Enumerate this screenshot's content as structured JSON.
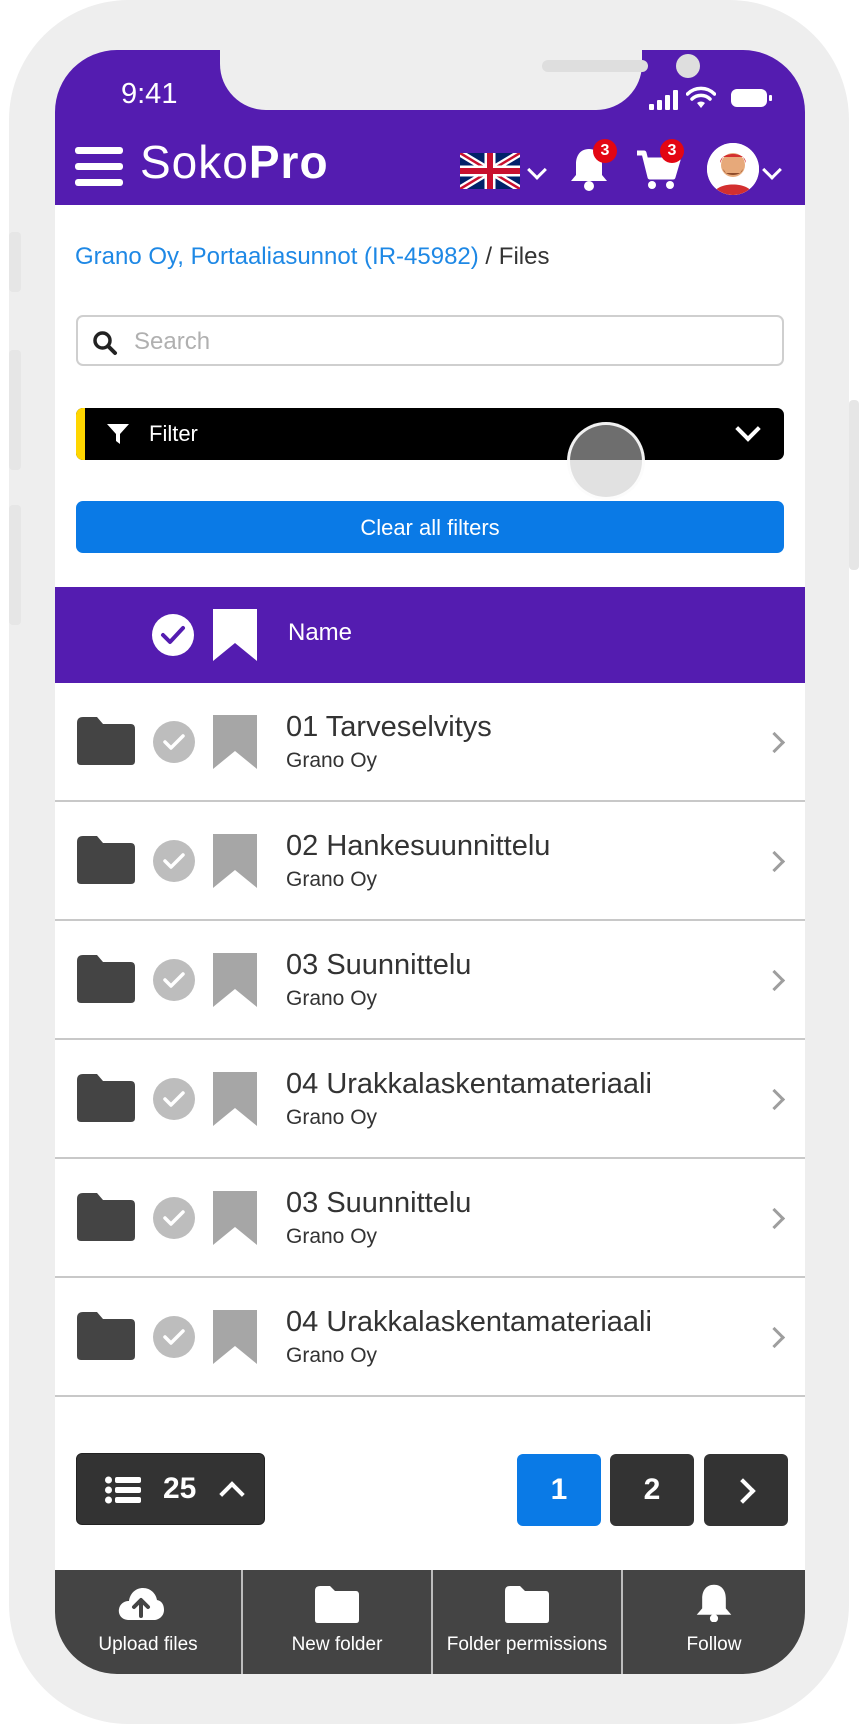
{
  "status_bar": {
    "time": "9:41"
  },
  "header": {
    "logo_light": "Soko",
    "logo_bold": "Pro",
    "notifications_count": "3",
    "cart_count": "3",
    "colors": {
      "brand": "#541cb0",
      "badge": "#e30613"
    }
  },
  "breadcrumb": {
    "link": "Grano Oy, Portaaliasunnot (IR-45982)",
    "separator": " / ",
    "current": "Files"
  },
  "search": {
    "placeholder": "Search",
    "value": ""
  },
  "filter": {
    "label": "Filter",
    "accent_color": "#ffd600"
  },
  "clear_filters": {
    "label": "Clear all filters",
    "color": "#0a7ae6"
  },
  "table": {
    "header": {
      "name": "Name"
    },
    "rows": [
      {
        "title": "01 Tarveselvitys",
        "owner": "Grano Oy"
      },
      {
        "title": "02 Hankesuunnittelu",
        "owner": "Grano Oy"
      },
      {
        "title": "03 Suunnittelu",
        "owner": "Grano Oy"
      },
      {
        "title": "04 Urakkalaskentamateriaali",
        "owner": "Grano Oy"
      },
      {
        "title": "03 Suunnittelu",
        "owner": "Grano Oy"
      },
      {
        "title": "04 Urakkalaskentamateriaali",
        "owner": "Grano Oy"
      }
    ]
  },
  "pagination": {
    "per_page": "25",
    "pages": [
      "1",
      "2"
    ],
    "current_page": "1"
  },
  "toolbar": {
    "upload_label": "Upload files",
    "new_folder_label": "New folder",
    "permissions_label": "Folder permissions",
    "follow_label": "Follow"
  }
}
